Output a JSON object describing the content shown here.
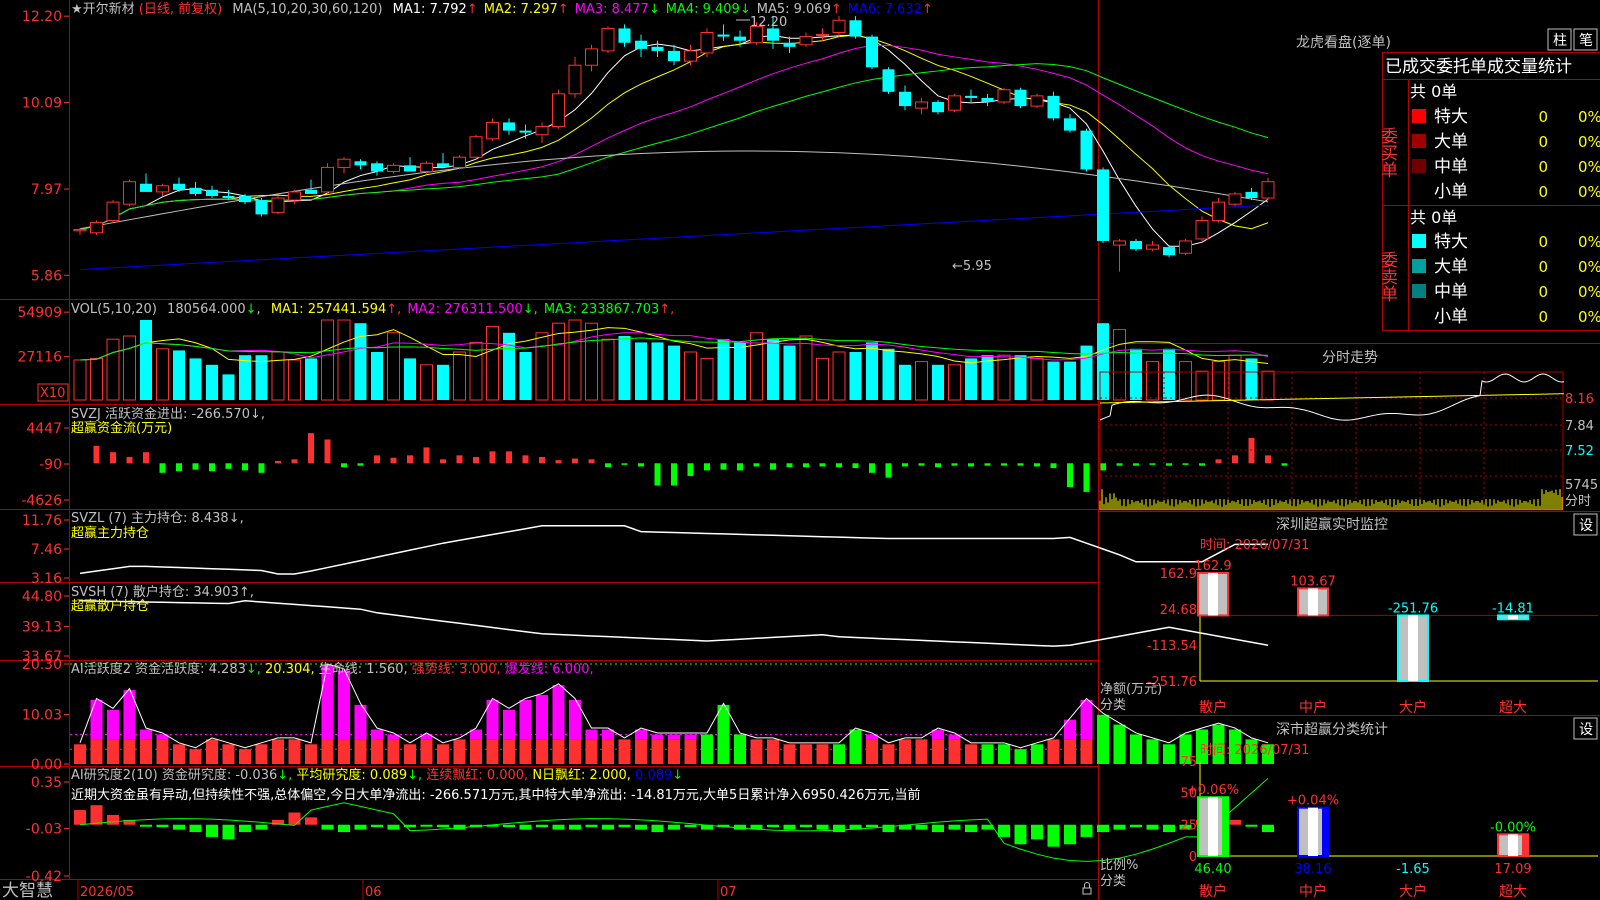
{
  "colors": {
    "up": "#ff3030",
    "down": "#00ffff",
    "white": "#ffffff",
    "yellow": "#ffff00",
    "magenta": "#ff00ff",
    "green": "#00ff00",
    "grey": "#c0c0c0",
    "blue": "#0000ff",
    "frame": "#b00000",
    "label": "#ff3030"
  },
  "main": {
    "title_star": "★开尔新材",
    "title_mode": "(日线, 前复权)",
    "ma_params": "MA(5,10,20,30,60,120)",
    "ma": [
      {
        "label": "MA1: 7.792",
        "arrow": "↑",
        "color": "#ffffff"
      },
      {
        "label": "MA2: 7.297",
        "arrow": "↑",
        "color": "#ffff00"
      },
      {
        "label": "MA3: 8.477",
        "arrow": "↓",
        "color": "#ff00ff"
      },
      {
        "label": "MA4: 9.409",
        "arrow": "↓",
        "color": "#00ff00"
      },
      {
        "label": "MA5: 9.069",
        "arrow": "↑",
        "color": "#c0c0c0"
      },
      {
        "label": "MA6: 7.632",
        "arrow": "↑",
        "color": "#0000ff"
      }
    ],
    "y_ticks": [
      "12.20",
      "10.09",
      "7.97",
      "5.86"
    ],
    "high_label": "12.20",
    "low_label": "←5.95"
  },
  "vol": {
    "params": "VOL(5,10,20)",
    "value": "180564.000",
    "value_arrow": "↓",
    "ma": [
      {
        "label": "MA1: 257441.594",
        "arrow": "↑",
        "color": "#ffff00"
      },
      {
        "label": "MA2: 276311.500",
        "arrow": "↓",
        "color": "#ff00ff"
      },
      {
        "label": "MA3: 233867.703",
        "arrow": "↑",
        "color": "#00ff00"
      }
    ],
    "y_ticks": [
      "54909",
      "27116"
    ],
    "unit": "X10"
  },
  "svzj": {
    "header": "SVZJ  活跃资金进出: -266.570↓,",
    "subtitle": "超赢资金流(万元)",
    "y_ticks": [
      "4447",
      "-90",
      "-4626"
    ]
  },
  "svzl": {
    "header": "SVZL (7) 主力持仓: 8.438↓,",
    "subtitle": "超赢主力持仓",
    "y_ticks": [
      "11.76",
      "7.46",
      "3.16"
    ]
  },
  "svsh": {
    "header": "SVSH (7) 散户持仓: 34.903↑,",
    "subtitle": "超赢散户持仓",
    "y_ticks": [
      "44.80",
      "39.13",
      "33.67"
    ]
  },
  "ai1": {
    "parts": [
      {
        "t": "AI活跃度2 资金活跃度: 4.283",
        "c": "#c0c0c0"
      },
      {
        "t": "↓,",
        "c": "#00ff00"
      },
      {
        "t": " 20.304,",
        "c": "#ffff00"
      },
      {
        "t": " 生命线: 1.560,",
        "c": "#c0c0c0"
      },
      {
        "t": " 强势线: 3.000,",
        "c": "#ff3030"
      },
      {
        "t": " 爆发线: 6.000,",
        "c": "#ff00ff"
      }
    ],
    "y_ticks": [
      "20.30",
      "10.03",
      "0.00"
    ]
  },
  "ai2": {
    "parts": [
      {
        "t": "AI研究度2(10) 资金研究度: -0.036",
        "c": "#c0c0c0"
      },
      {
        "t": "↓,",
        "c": "#00ff00"
      },
      {
        "t": " 平均研究度: 0.089",
        "c": "#ffff00"
      },
      {
        "t": "↓,",
        "c": "#00ff00"
      },
      {
        "t": " 连续飘红: 0.000,",
        "c": "#ff3030"
      },
      {
        "t": " N日飘红: 2.000,",
        "c": "#ffff00"
      },
      {
        "t": " 0.089",
        "c": "#0000ff"
      },
      {
        "t": "↓",
        "c": "#00ff00"
      }
    ],
    "comment": "近期大资金虽有异动,但持续性不强,总体偏空,今日大单净流出: -266.571万元,其中特大单净流出: -14.81万元,大单5日累计净入6950.426万元,当前",
    "y_ticks": [
      "0.35",
      "-0.03",
      "-0.42"
    ]
  },
  "bottom": {
    "brand": "大智慧",
    "date_start": "2026/05",
    "month2": "06",
    "month3": "07"
  },
  "dragon": {
    "title": "龙虎看盘(逐单)",
    "btn1": "柱",
    "btn2": "笔",
    "header": "已成交委托单成交量统计",
    "buy_label": "委买单",
    "sell_label": "委卖单",
    "buy_total": "共 0单",
    "sell_total": "共 0单",
    "buy_rows": [
      {
        "name": "特大",
        "color": "#ff0000",
        "v": "0",
        "p": "0%"
      },
      {
        "name": "大单",
        "color": "#a00000",
        "v": "0",
        "p": "0%"
      },
      {
        "name": "中单",
        "color": "#700000",
        "v": "0",
        "p": "0%"
      },
      {
        "name": "小单",
        "color": "",
        "v": "0",
        "p": "0%"
      }
    ],
    "sell_rows": [
      {
        "name": "特大",
        "color": "#00ffff",
        "v": "0",
        "p": "0%"
      },
      {
        "name": "大单",
        "color": "#00a0a0",
        "v": "0",
        "p": "0%"
      },
      {
        "name": "中单",
        "color": "#008080",
        "v": "0",
        "p": "0%"
      },
      {
        "name": "小单",
        "color": "",
        "v": "0",
        "p": "0%"
      }
    ]
  },
  "intraday": {
    "title": "分时走势",
    "y_ticks": [
      "8.16",
      "7.84",
      "7.52"
    ],
    "vol_tick": "5745",
    "vol_label": "分时"
  },
  "sz_monitor": {
    "title": "深圳超赢实时监控",
    "btn": "设",
    "time": "时间: 2026/07/31",
    "y_ticks": [
      "162.9",
      "24.68",
      "-113.54",
      "-251.76"
    ],
    "axis_label1": "净额(万元)",
    "axis_label2": "分类",
    "categories": [
      "散户",
      "中户",
      "大户",
      "超大"
    ],
    "values": [
      162.9,
      103.67,
      -251.76,
      -14.81
    ],
    "value_labels": [
      "162.9",
      "103.67",
      "-251.76",
      "-14.81"
    ]
  },
  "sz_class": {
    "title": "深市超赢分类统计",
    "btn": "设",
    "time": "时间: 2026/07/31",
    "y_ticks": [
      "75",
      "50",
      "25",
      "0"
    ],
    "axis_label1": "比例%",
    "axis_label2": "分类",
    "categories": [
      "散户",
      "中户",
      "大户",
      "超大"
    ],
    "values": [
      46.4,
      38.16,
      -1.65,
      17.09
    ],
    "value_labels": [
      "46.40",
      "38.16",
      "-1.65",
      "17.09"
    ],
    "change_labels": [
      "+0.06%",
      "+0.04%",
      "",
      "-0.00%"
    ]
  },
  "chart_data": [
    {
      "type": "candlestick",
      "title": "★开尔新材 (日线, 前复权)",
      "yticks": [
        12.2,
        10.09,
        7.97,
        5.86
      ],
      "ylim": [
        5.5,
        12.4
      ],
      "ohlc": [
        [
          6.95,
          7.02,
          6.85,
          6.98
        ],
        [
          6.9,
          7.2,
          6.85,
          7.15
        ],
        [
          7.2,
          7.7,
          7.15,
          7.65
        ],
        [
          7.6,
          8.2,
          7.55,
          8.15
        ],
        [
          8.1,
          8.35,
          7.95,
          7.9
        ],
        [
          7.9,
          8.1,
          7.8,
          8.05
        ],
        [
          8.1,
          8.25,
          7.9,
          7.95
        ],
        [
          8.0,
          8.15,
          7.8,
          7.85
        ],
        [
          7.95,
          8.05,
          7.75,
          7.8
        ],
        [
          7.8,
          7.95,
          7.7,
          7.75
        ],
        [
          7.8,
          7.85,
          7.6,
          7.65
        ],
        [
          7.7,
          7.75,
          7.3,
          7.35
        ],
        [
          7.4,
          7.8,
          7.35,
          7.75
        ],
        [
          7.7,
          7.95,
          7.6,
          7.9
        ],
        [
          7.95,
          8.2,
          7.9,
          7.85
        ],
        [
          7.9,
          8.6,
          7.85,
          8.5
        ],
        [
          8.5,
          8.75,
          8.35,
          8.7
        ],
        [
          8.65,
          8.7,
          8.45,
          8.55
        ],
        [
          8.6,
          8.65,
          8.3,
          8.4
        ],
        [
          8.4,
          8.6,
          8.35,
          8.55
        ],
        [
          8.55,
          8.75,
          8.45,
          8.4
        ],
        [
          8.4,
          8.65,
          8.35,
          8.6
        ],
        [
          8.6,
          8.85,
          8.5,
          8.5
        ],
        [
          8.5,
          8.8,
          8.45,
          8.75
        ],
        [
          8.75,
          9.3,
          8.7,
          9.25
        ],
        [
          9.2,
          9.7,
          9.15,
          9.6
        ],
        [
          9.6,
          9.7,
          9.3,
          9.4
        ],
        [
          9.4,
          9.55,
          9.2,
          9.35
        ],
        [
          9.3,
          9.6,
          9.1,
          9.5
        ],
        [
          9.5,
          10.4,
          9.45,
          10.3
        ],
        [
          10.3,
          11.2,
          10.2,
          11.0
        ],
        [
          11.0,
          11.5,
          10.85,
          11.4
        ],
        [
          11.35,
          11.95,
          11.3,
          11.9
        ],
        [
          11.9,
          12.0,
          11.45,
          11.55
        ],
        [
          11.6,
          11.75,
          11.2,
          11.4
        ],
        [
          11.45,
          11.6,
          11.2,
          11.35
        ],
        [
          11.35,
          11.5,
          11.0,
          11.1
        ],
        [
          11.1,
          11.5,
          11.0,
          11.35
        ],
        [
          11.3,
          11.9,
          11.2,
          11.8
        ],
        [
          11.75,
          12.0,
          11.6,
          11.7
        ],
        [
          11.7,
          11.85,
          11.45,
          11.6
        ],
        [
          11.55,
          12.05,
          11.5,
          11.95
        ],
        [
          11.9,
          12.2,
          11.4,
          11.6
        ],
        [
          11.55,
          11.7,
          11.3,
          11.45
        ],
        [
          11.5,
          11.8,
          11.45,
          11.7
        ],
        [
          11.75,
          11.9,
          11.6,
          11.75
        ],
        [
          11.8,
          12.2,
          11.7,
          12.1
        ],
        [
          12.1,
          12.2,
          11.65,
          11.7
        ],
        [
          11.7,
          11.75,
          10.9,
          10.95
        ],
        [
          10.9,
          10.95,
          10.3,
          10.35
        ],
        [
          10.35,
          10.5,
          9.9,
          10.0
        ],
        [
          9.95,
          10.2,
          9.8,
          10.1
        ],
        [
          10.1,
          10.15,
          9.8,
          9.85
        ],
        [
          9.9,
          10.3,
          9.85,
          10.25
        ],
        [
          10.25,
          10.4,
          10.1,
          10.2
        ],
        [
          10.2,
          10.3,
          10.0,
          10.1
        ],
        [
          10.1,
          10.45,
          10.05,
          10.4
        ],
        [
          10.4,
          10.45,
          9.95,
          10.0
        ],
        [
          10.0,
          10.3,
          9.95,
          10.25
        ],
        [
          10.25,
          10.35,
          9.65,
          9.7
        ],
        [
          9.7,
          9.8,
          9.35,
          9.4
        ],
        [
          9.4,
          9.45,
          8.4,
          8.45
        ],
        [
          8.45,
          8.5,
          6.65,
          6.7
        ],
        [
          6.6,
          6.75,
          5.95,
          6.7
        ],
        [
          6.7,
          6.75,
          6.45,
          6.5
        ],
        [
          6.5,
          6.7,
          6.45,
          6.6
        ],
        [
          6.55,
          6.6,
          6.3,
          6.35
        ],
        [
          6.4,
          6.75,
          6.35,
          6.7
        ],
        [
          6.75,
          7.3,
          6.7,
          7.2
        ],
        [
          7.2,
          7.75,
          7.15,
          7.65
        ],
        [
          7.6,
          7.9,
          7.55,
          7.85
        ],
        [
          7.9,
          8.0,
          7.7,
          7.75
        ],
        [
          7.75,
          8.25,
          7.7,
          8.15
        ]
      ]
    },
    {
      "type": "bar",
      "title": "VOL(5,10,20)",
      "yticks": [
        54909,
        27116
      ],
      "ylim": [
        0,
        60000
      ],
      "values": [
        25000,
        26000,
        38000,
        40000,
        50000,
        32000,
        31000,
        26000,
        22000,
        16000,
        28000,
        28000,
        30000,
        25000,
        26000,
        50000,
        50000,
        48000,
        30000,
        42000,
        26000,
        22000,
        22000,
        30000,
        36000,
        46000,
        42000,
        30000,
        42000,
        48000,
        50000,
        48000,
        38000,
        40000,
        36000,
        36000,
        34000,
        30000,
        26000,
        38000,
        36000,
        42000,
        38000,
        34000,
        40000,
        26000,
        30000,
        30000,
        36000,
        32000,
        22000,
        24000,
        22000,
        22000,
        26000,
        28000,
        28000,
        28000,
        26000,
        24000,
        24000,
        34000,
        48000,
        44000,
        32000,
        24000,
        32000,
        24000,
        18000,
        24000,
        28000,
        26000,
        18000
      ],
      "up": [
        1,
        1,
        1,
        1,
        0,
        1,
        0,
        0,
        0,
        0,
        0,
        0,
        1,
        1,
        0,
        1,
        1,
        0,
        0,
        1,
        0,
        1,
        0,
        1,
        1,
        1,
        0,
        0,
        1,
        1,
        1,
        1,
        1,
        0,
        0,
        0,
        0,
        1,
        1,
        0,
        0,
        1,
        0,
        0,
        1,
        1,
        1,
        0,
        0,
        0,
        0,
        1,
        0,
        1,
        0,
        0,
        1,
        0,
        1,
        0,
        0,
        0,
        0,
        1,
        0,
        1,
        0,
        1,
        1,
        1,
        1,
        0,
        1
      ]
    },
    {
      "type": "bar",
      "title": "SVZJ 超赢资金流(万元)",
      "yticks": [
        4447,
        -90,
        -4626
      ],
      "ylim": [
        -4626,
        4447
      ],
      "values": [
        0,
        2200,
        1400,
        800,
        1400,
        -1200,
        -1000,
        -800,
        -1000,
        -700,
        -900,
        -1200,
        300,
        500,
        3800,
        3000,
        -500,
        -300,
        1000,
        700,
        1000,
        2000,
        500,
        1000,
        800,
        1500,
        1500,
        1000,
        800,
        400,
        600,
        500,
        -500,
        -200,
        -400,
        -2800,
        -2800,
        -1600,
        -900,
        -800,
        -900,
        -400,
        -800,
        -500,
        -500,
        -400,
        -500,
        -600,
        -1200,
        -1800,
        -400,
        -300,
        -500,
        -300,
        -400,
        -300,
        -300,
        -300,
        -400,
        -600,
        -3000,
        -3600,
        -900,
        -300,
        -300,
        -200,
        -300,
        -200,
        -300,
        500,
        1000,
        3200,
        1000,
        -300
      ]
    },
    {
      "type": "line",
      "title": "SVZL 超赢主力持仓",
      "yticks": [
        11.76,
        7.46,
        3.16
      ],
      "ylim": [
        3.16,
        11.76
      ]
    },
    {
      "type": "line",
      "title": "SVSH 超赢散户持仓",
      "yticks": [
        44.8,
        39.13,
        33.67
      ],
      "ylim": [
        33.67,
        44.8
      ]
    },
    {
      "type": "bar",
      "title": "AI活跃度2",
      "yticks": [
        20.3,
        10.03,
        0.0
      ],
      "ylim": [
        0,
        20.3
      ]
    },
    {
      "type": "bar",
      "title": "AI研究度2(10)",
      "yticks": [
        0.35,
        -0.03,
        -0.42
      ],
      "ylim": [
        -0.42,
        0.35
      ]
    },
    {
      "type": "bar",
      "title": "深圳超赢实时监控",
      "categories": [
        "散户",
        "中户",
        "大户",
        "超大"
      ],
      "values": [
        162.9,
        103.67,
        -251.76,
        -14.81
      ],
      "ylim": [
        -251.76,
        162.9
      ]
    },
    {
      "type": "bar",
      "title": "深市超赢分类统计",
      "categories": [
        "散户",
        "中户",
        "大户",
        "超大"
      ],
      "values": [
        46.4,
        38.16,
        -1.65,
        17.09
      ],
      "ylim": [
        0,
        75
      ]
    }
  ]
}
